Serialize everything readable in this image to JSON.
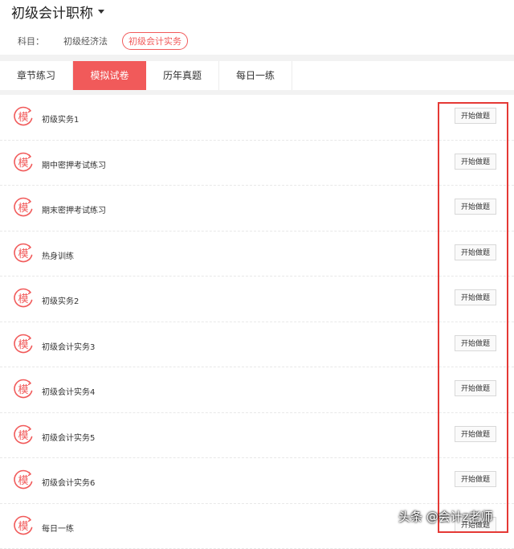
{
  "header": {
    "title": "初级会计职称",
    "subject_label": "科目：",
    "subjects": [
      {
        "label": "初级经济法",
        "selected": false
      },
      {
        "label": "初级会计实务",
        "selected": true
      }
    ]
  },
  "tabs": [
    {
      "label": "章节练习",
      "active": false
    },
    {
      "label": "模拟试卷",
      "active": true
    },
    {
      "label": "历年真题",
      "active": false
    },
    {
      "label": "每日一练",
      "active": false
    }
  ],
  "list": {
    "icon_glyph": "模",
    "items": [
      {
        "name": "初级实务1",
        "button": "开始做题"
      },
      {
        "name": "期中密押考试练习",
        "button": "开始做题"
      },
      {
        "name": "期末密押考试练习",
        "button": "开始做题"
      },
      {
        "name": "热身训练",
        "button": "开始做题"
      },
      {
        "name": "初级实务2",
        "button": "开始做题"
      },
      {
        "name": "初级会计实务3",
        "button": "开始做题"
      },
      {
        "name": "初级会计实务4",
        "button": "开始做题"
      },
      {
        "name": "初级会计实务5",
        "button": "开始做题"
      },
      {
        "name": "初级会计实务6",
        "button": "开始做题"
      },
      {
        "name": "每日一练",
        "button": "开始做题"
      }
    ]
  },
  "watermark": "头条 @会计z老师",
  "colors": {
    "accent": "#f15a5a",
    "highlight": "#e53935"
  }
}
